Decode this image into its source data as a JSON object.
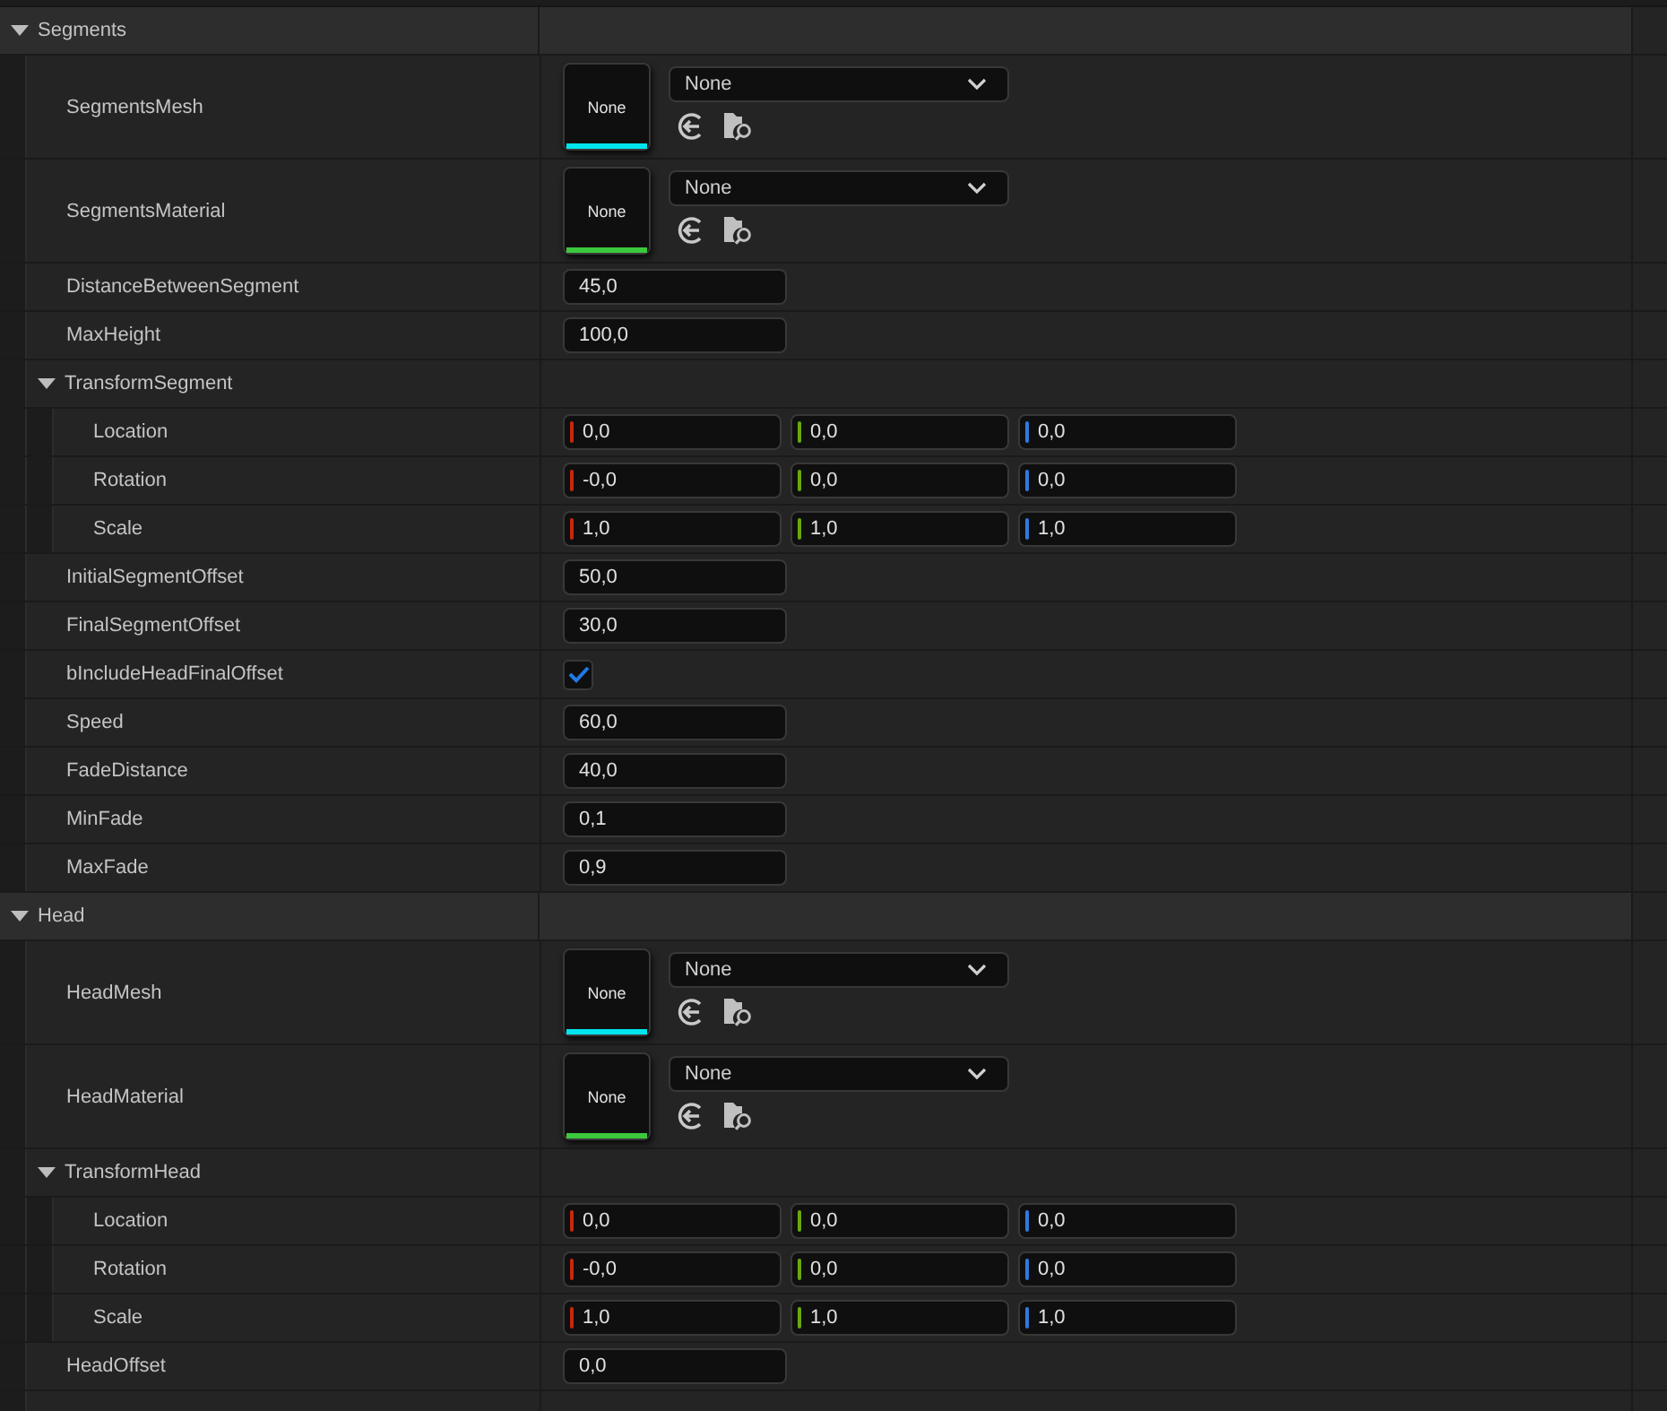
{
  "sections": [
    {
      "title": "Segments",
      "expanded": true,
      "rows": [
        {
          "kind": "asset",
          "label": "SegmentsMesh",
          "thumb": "None",
          "value": "None",
          "color": "#00e5ee"
        },
        {
          "kind": "asset",
          "label": "SegmentsMaterial",
          "thumb": "None",
          "value": "None",
          "color": "#3cc83c"
        },
        {
          "kind": "number",
          "label": "DistanceBetweenSegment",
          "value": "45,0"
        },
        {
          "kind": "number",
          "label": "MaxHeight",
          "value": "100,0"
        },
        {
          "kind": "group",
          "label": "TransformSegment",
          "expanded": true,
          "children": [
            {
              "kind": "vector",
              "label": "Location",
              "values": [
                "0,0",
                "0,0",
                "0,0"
              ]
            },
            {
              "kind": "vector",
              "label": "Rotation",
              "values": [
                "-0,0",
                "0,0",
                "0,0"
              ]
            },
            {
              "kind": "vector",
              "label": "Scale",
              "values": [
                "1,0",
                "1,0",
                "1,0"
              ]
            }
          ]
        },
        {
          "kind": "number",
          "label": "InitialSegmentOffset",
          "value": "50,0"
        },
        {
          "kind": "number",
          "label": "FinalSegmentOffset",
          "value": "30,0"
        },
        {
          "kind": "checkbox",
          "label": "bIncludeHeadFinalOffset",
          "checked": true
        },
        {
          "kind": "number",
          "label": "Speed",
          "value": "60,0"
        },
        {
          "kind": "number",
          "label": "FadeDistance",
          "value": "40,0"
        },
        {
          "kind": "number",
          "label": "MinFade",
          "value": "0,1"
        },
        {
          "kind": "number",
          "label": "MaxFade",
          "value": "0,9"
        }
      ]
    },
    {
      "title": "Head",
      "expanded": true,
      "rows": [
        {
          "kind": "asset",
          "label": "HeadMesh",
          "thumb": "None",
          "value": "None",
          "color": "#00e5ee"
        },
        {
          "kind": "asset",
          "label": "HeadMaterial",
          "thumb": "None",
          "value": "None",
          "color": "#3cc83c"
        },
        {
          "kind": "group",
          "label": "TransformHead",
          "expanded": true,
          "children": [
            {
              "kind": "vector",
              "label": "Location",
              "values": [
                "0,0",
                "0,0",
                "0,0"
              ]
            },
            {
              "kind": "vector",
              "label": "Rotation",
              "values": [
                "-0,0",
                "0,0",
                "0,0"
              ]
            },
            {
              "kind": "vector",
              "label": "Scale",
              "values": [
                "1,0",
                "1,0",
                "1,0"
              ]
            }
          ]
        },
        {
          "kind": "number",
          "label": "HeadOffset",
          "value": "0,0"
        }
      ]
    }
  ]
}
